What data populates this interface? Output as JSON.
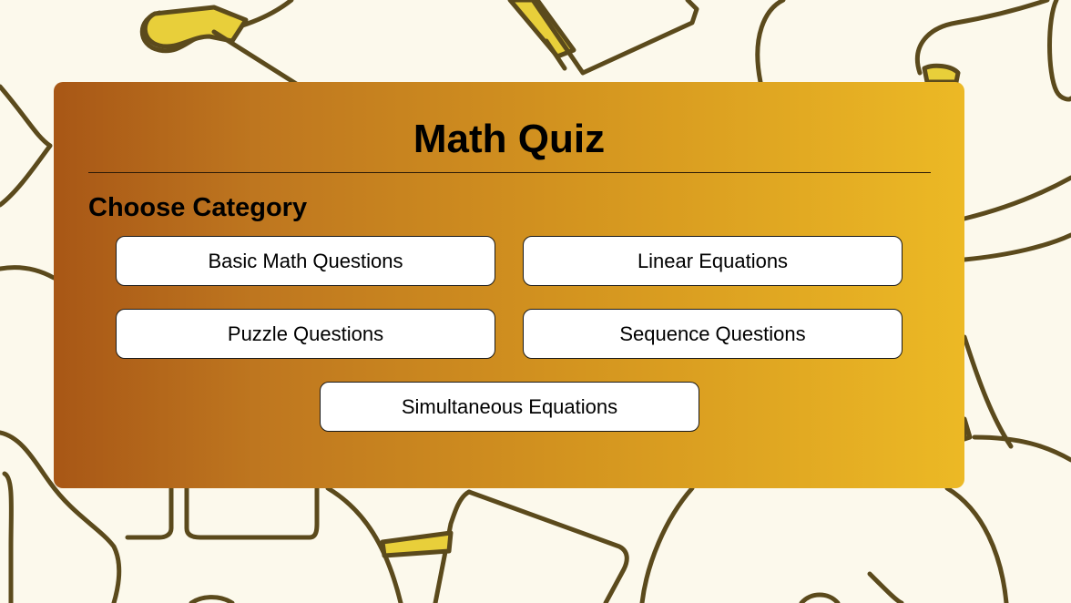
{
  "quiz": {
    "title": "Math Quiz",
    "subtitle": "Choose Category",
    "categories": [
      "Basic Math Questions",
      "Linear Equations",
      "Puzzle Questions",
      "Sequence Questions",
      "Simultaneous Equations"
    ]
  },
  "colors": {
    "background": "#fcf9ec",
    "doodle_stroke": "#5b4a1c",
    "doodle_fill": "#e8cf3a",
    "card_gradient_start": "#a85716",
    "card_gradient_end": "#ecb925",
    "button_background": "#ffffff"
  }
}
